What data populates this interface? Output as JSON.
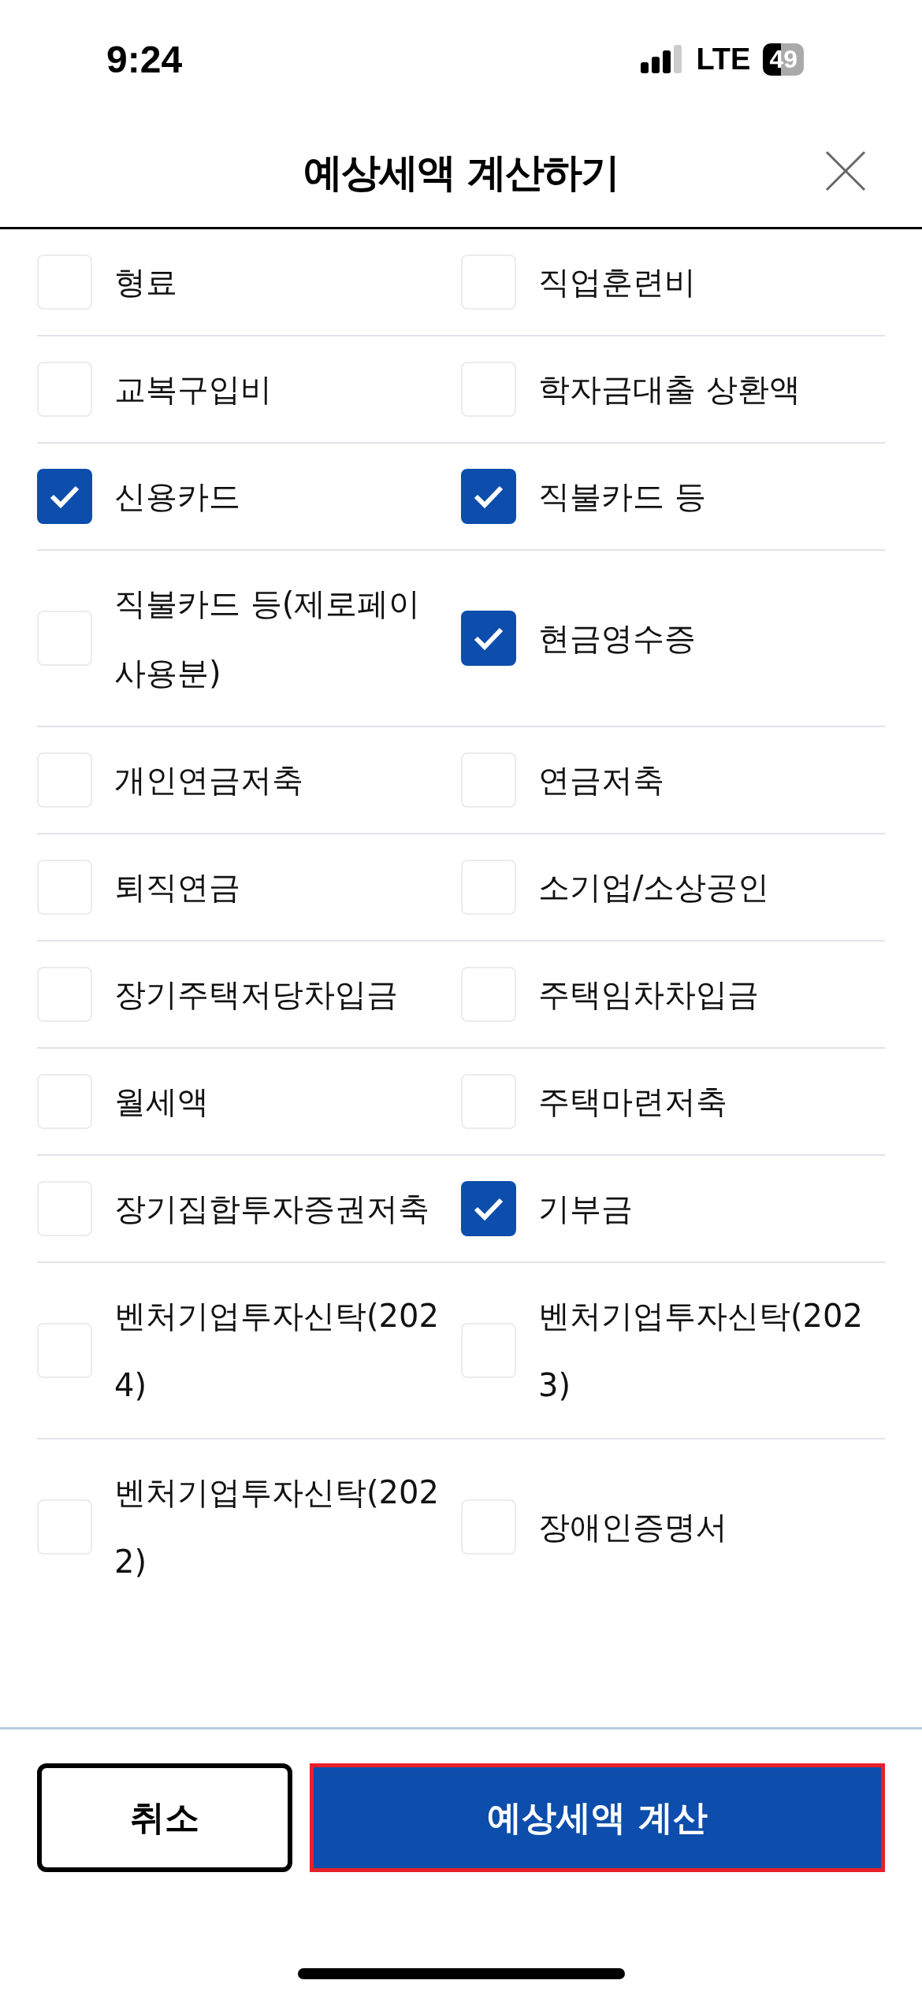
{
  "status_bar": {
    "time": "9:24",
    "network": "LTE",
    "battery": "49"
  },
  "header": {
    "title": "예상세액 계산하기"
  },
  "rows": [
    [
      {
        "label": "형료",
        "checked": false
      },
      {
        "label": "직업훈련비",
        "checked": false
      }
    ],
    [
      {
        "label": "교복구입비",
        "checked": false
      },
      {
        "label": "학자금대출 상환액",
        "checked": false
      }
    ],
    [
      {
        "label": "신용카드",
        "checked": true
      },
      {
        "label": "직불카드 등",
        "checked": true
      }
    ],
    [
      {
        "label": "직불카드 등(제로페이 사용분)",
        "checked": false
      },
      {
        "label": "현금영수증",
        "checked": true
      }
    ],
    [
      {
        "label": "개인연금저축",
        "checked": false
      },
      {
        "label": "연금저축",
        "checked": false
      }
    ],
    [
      {
        "label": "퇴직연금",
        "checked": false
      },
      {
        "label": "소기업/소상공인",
        "checked": false
      }
    ],
    [
      {
        "label": "장기주택저당차입금",
        "checked": false
      },
      {
        "label": "주택임차차입금",
        "checked": false
      }
    ],
    [
      {
        "label": "월세액",
        "checked": false
      },
      {
        "label": "주택마련저축",
        "checked": false
      }
    ],
    [
      {
        "label": "장기집합투자증권저축",
        "checked": false
      },
      {
        "label": "기부금",
        "checked": true
      }
    ],
    [
      {
        "label": "벤처기업투자신탁(2024)",
        "checked": false
      },
      {
        "label": "벤처기업투자신탁(2023)",
        "checked": false
      }
    ],
    [
      {
        "label": "벤처기업투자신탁(2022)",
        "checked": false
      },
      {
        "label": "장애인증명서",
        "checked": false
      }
    ]
  ],
  "buttons": [
    {
      "label": "취소",
      "kind": "secondary"
    },
    {
      "label": "예상세액 계산",
      "kind": "primary"
    }
  ]
}
